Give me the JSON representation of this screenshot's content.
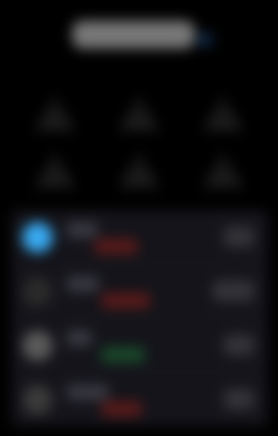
{
  "header": {
    "title": "",
    "status_color": "#1e4f86"
  },
  "grid": {
    "items": [
      {
        "name": "grid-item-1",
        "icon": "triangle-icon"
      },
      {
        "name": "grid-item-2",
        "icon": "triangle-icon"
      },
      {
        "name": "grid-item-3",
        "icon": "triangle-icon"
      },
      {
        "name": "grid-item-4",
        "icon": "triangle-icon"
      },
      {
        "name": "grid-item-5",
        "icon": "triangle-icon"
      },
      {
        "name": "grid-item-6",
        "icon": "triangle-icon"
      }
    ]
  },
  "list": {
    "rows": [
      {
        "title": "",
        "badge_color": "#5a1a1a",
        "avatar_color": "#39aaf2"
      },
      {
        "title": "",
        "badge_color": "#5a1a1a",
        "avatar_color": "#2a2a2a"
      },
      {
        "title": "",
        "badge_color": "#1a4a2a",
        "avatar_color": "#5a5a5a"
      },
      {
        "title": "",
        "badge_color": "#5a1a1a",
        "avatar_color": "#3a3a3a"
      }
    ]
  },
  "colors": {
    "background": "#000000",
    "card": "#14141a",
    "accent": "#39aaf2"
  }
}
